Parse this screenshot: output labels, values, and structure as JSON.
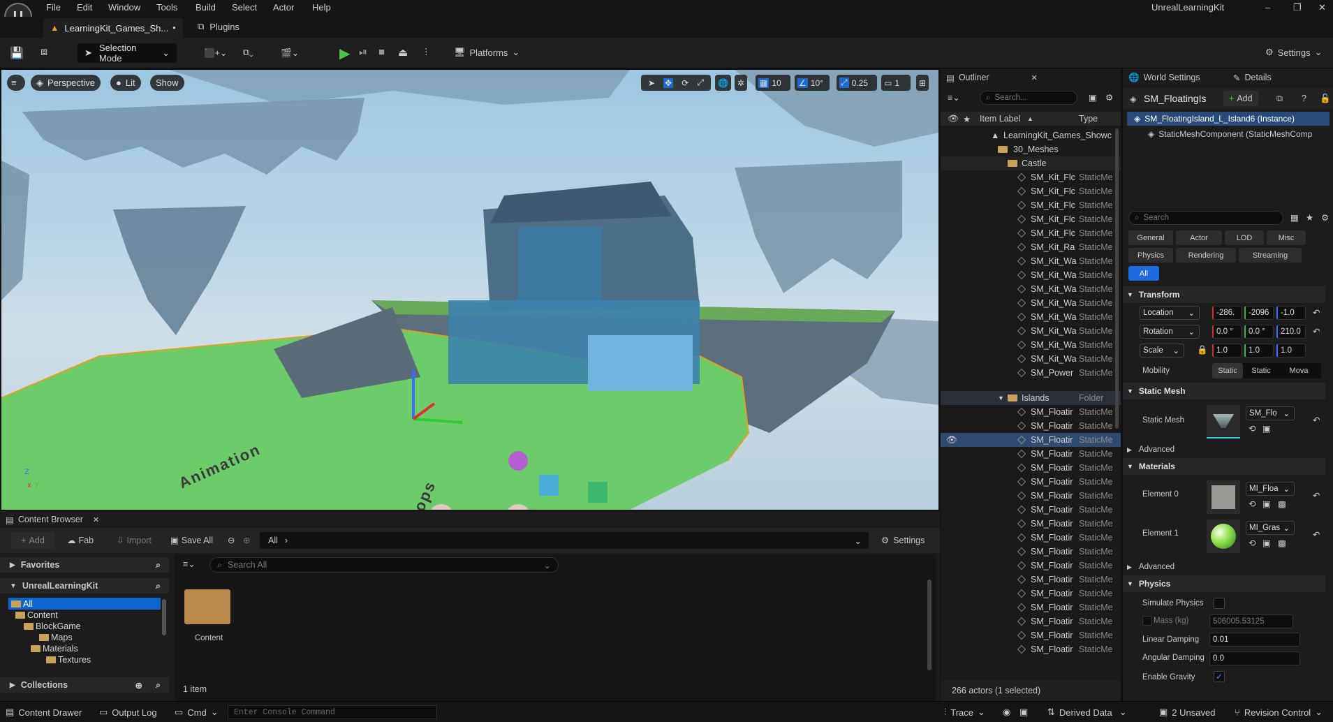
{
  "app": {
    "title": "UnrealLearningKit"
  },
  "menu": [
    "File",
    "Edit",
    "Window",
    "Tools",
    "Build",
    "Select",
    "Actor",
    "Help"
  ],
  "tabs": {
    "level": "LearningKit_Games_Sh...",
    "modified": "•",
    "plugins": "Plugins"
  },
  "toolbar": {
    "selection_mode": "Selection Mode",
    "platforms": "Platforms",
    "settings": "Settings"
  },
  "viewport": {
    "perspective": "Perspective",
    "lit": "Lit",
    "show": "Show",
    "grid": "10",
    "rot": "10°",
    "scale": "0.25",
    "cams": "1",
    "text_animation": "Animation",
    "text_props": "Props"
  },
  "content_browser": {
    "tab": "Content Browser",
    "add": "Add",
    "fab": "Fab",
    "import": "Import",
    "save_all": "Save All",
    "path_all": "All",
    "settings": "Settings",
    "search_placeholder": "Search All",
    "favorites": "Favorites",
    "project": "UnrealLearningKit",
    "collections": "Collections",
    "tree": [
      "All",
      "Content",
      "BlockGame",
      "Maps",
      "Materials",
      "Textures"
    ],
    "asset_label": "Content",
    "item_count": "1 item"
  },
  "outliner": {
    "tab": "Outliner",
    "search_placeholder": "Search...",
    "col_label": "Item Label",
    "col_type": "Type",
    "root": "LearningKit_Games_Showc",
    "folder1": "30_Meshes",
    "folder2": "Castle",
    "folder3": "Islands",
    "folder3_type": "Folder",
    "castle_rows": [
      {
        "l": "SM_Kit_Flc",
        "t": "StaticMe"
      },
      {
        "l": "SM_Kit_Flc",
        "t": "StaticMe"
      },
      {
        "l": "SM_Kit_Flc",
        "t": "StaticMe"
      },
      {
        "l": "SM_Kit_Flc",
        "t": "StaticMe"
      },
      {
        "l": "SM_Kit_Flc",
        "t": "StaticMe"
      },
      {
        "l": "SM_Kit_Ra",
        "t": "StaticMe"
      },
      {
        "l": "SM_Kit_Wa",
        "t": "StaticMe"
      },
      {
        "l": "SM_Kit_Wa",
        "t": "StaticMe"
      },
      {
        "l": "SM_Kit_Wa",
        "t": "StaticMe"
      },
      {
        "l": "SM_Kit_Wa",
        "t": "StaticMe"
      },
      {
        "l": "SM_Kit_Wa",
        "t": "StaticMe"
      },
      {
        "l": "SM_Kit_Wa",
        "t": "StaticMe"
      },
      {
        "l": "SM_Kit_Wa",
        "t": "StaticMe"
      },
      {
        "l": "SM_Kit_Wa",
        "t": "StaticMe"
      },
      {
        "l": "SM_Power",
        "t": "StaticMe"
      }
    ],
    "island_rows": [
      "SM_Floatir",
      "SM_Floatir",
      "SM_Floatir",
      "SM_Floatir",
      "SM_Floatir",
      "SM_Floatir",
      "SM_Floatir",
      "SM_Floatir",
      "SM_Floatir",
      "SM_Floatir",
      "SM_Floatir",
      "SM_Floatir",
      "SM_Floatir",
      "SM_Floatir",
      "SM_Floatir",
      "SM_Floatir",
      "SM_Floatir",
      "SM_Floatir"
    ],
    "island_type": "StaticMe",
    "actors": "266 actors (1 selected)"
  },
  "details": {
    "tab_world": "World Settings",
    "tab_details": "Details",
    "object": "SM_FloatingIs",
    "add": "Add",
    "instance": "SM_FloatingIsland_L_Island6 (Instance)",
    "component": "StaticMeshComponent (StaticMeshComp",
    "search_placeholder": "Search",
    "filters": [
      "General",
      "Actor",
      "LOD",
      "Misc",
      "Physics",
      "Rendering",
      "Streaming",
      "All"
    ],
    "transform": "Transform",
    "location": "Location",
    "rotation": "Rotation",
    "scale": "Scale",
    "mobility": "Mobility",
    "loc": [
      "-286.",
      "-2096",
      "-1.0"
    ],
    "rot": [
      "0.0 °",
      "0.0 °",
      "210.0"
    ],
    "scl": [
      "1.0",
      "1.0",
      "1.0"
    ],
    "mob": [
      "Static",
      "Static",
      "Mova"
    ],
    "static_mesh_sec": "Static Mesh",
    "static_mesh": "Static Mesh",
    "mesh_value": "SM_Flo",
    "advanced": "Advanced",
    "materials_sec": "Materials",
    "element0": "Element 0",
    "element1": "Element 1",
    "mat0": "MI_Floa",
    "mat1": "MI_Gras",
    "physics_sec": "Physics",
    "simulate": "Simulate Physics",
    "mass": "Mass (kg)",
    "mass_val": "506005.53125",
    "linear": "Linear Damping",
    "linear_val": "0.01",
    "angular": "Angular Damping",
    "angular_val": "0.0",
    "gravity": "Enable Gravity"
  },
  "status": {
    "drawer": "Content Drawer",
    "output": "Output Log",
    "cmd": "Cmd",
    "console_placeholder": "Enter Console Command",
    "trace": "Trace",
    "derived": "Derived Data",
    "unsaved": "2 Unsaved",
    "revision": "Revision Control"
  }
}
